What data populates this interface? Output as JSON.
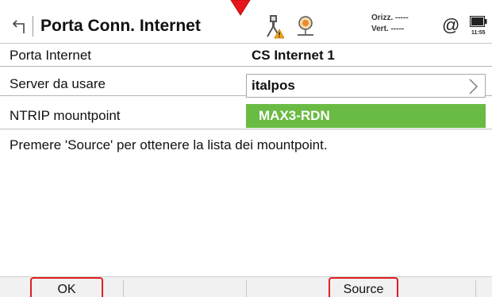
{
  "header": {
    "title": "Porta Conn. Internet",
    "quality_horizontal": "Orizz. -----",
    "quality_vertical": "Vert.  -----",
    "at_symbol": "@",
    "battery_time": "11:55"
  },
  "rows": {
    "port_label": "Porta Internet",
    "port_value": "CS Internet 1",
    "server_label": "Server da usare",
    "server_value": "italpos",
    "mount_label": "NTRIP mountpoint",
    "mount_value": "MAX3-RDN"
  },
  "info_text": "Premere 'Source' per ottenere la lista dei mountpoint.",
  "buttons": {
    "ok": "OK",
    "source": "Source"
  },
  "colors": {
    "highlight_green": "#6abb44",
    "callout_red": "#e02020"
  },
  "icons": [
    "back-arrow-icon",
    "instrument-warning-icon",
    "satellite-icon",
    "battery-icon",
    "chevron-right-icon",
    "callout-arrow-icon"
  ]
}
